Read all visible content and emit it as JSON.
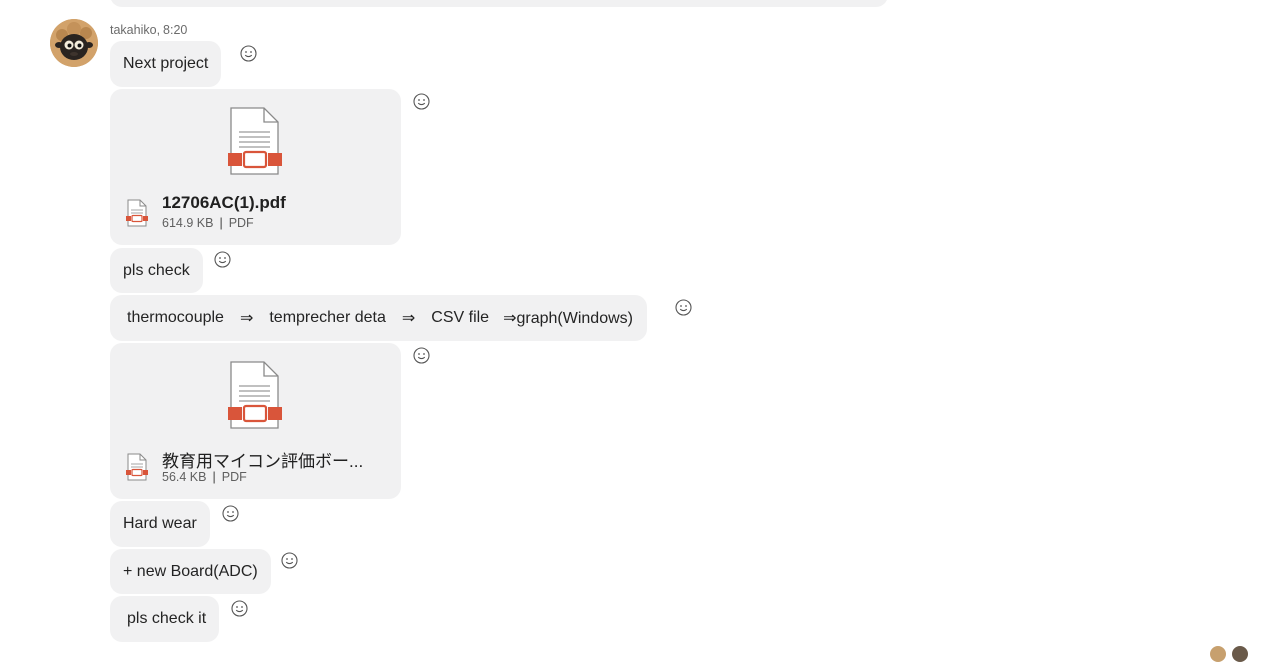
{
  "conversation": {
    "sender": {
      "name": "takahiko",
      "time": "8:20",
      "separator": ","
    },
    "messages": [
      {
        "kind": "text",
        "text": "Next project"
      },
      {
        "kind": "file",
        "file_name": "12706AC(1).pdf",
        "size": "614.9 KB",
        "file_type": "PDF",
        "icon": "pdf-file-icon"
      },
      {
        "kind": "text",
        "text": "pls check"
      },
      {
        "kind": "flow",
        "parts": [
          "thermocouple",
          "⇒",
          "temprecher deta",
          "⇒",
          "CSV file",
          "⇒graph(Windows)"
        ]
      },
      {
        "kind": "file",
        "file_name": "教育用マイコン評価ボー...",
        "size": "56.4 KB",
        "file_type": "PDF",
        "icon": "pdf-file-icon"
      },
      {
        "kind": "text",
        "text": "Hard wear"
      },
      {
        "kind": "text",
        "text": "+ new Board(ADC)"
      },
      {
        "kind": "text",
        "text": "pls check it"
      }
    ]
  },
  "meta_separator": "|",
  "icons": {
    "reaction": "smiley-icon",
    "avatar": "sheep-avatar"
  },
  "colors": {
    "bubble": "#f1f1f2",
    "pdf_red": "#d9553a",
    "text": "#242424",
    "muted": "#6b6b6b"
  }
}
